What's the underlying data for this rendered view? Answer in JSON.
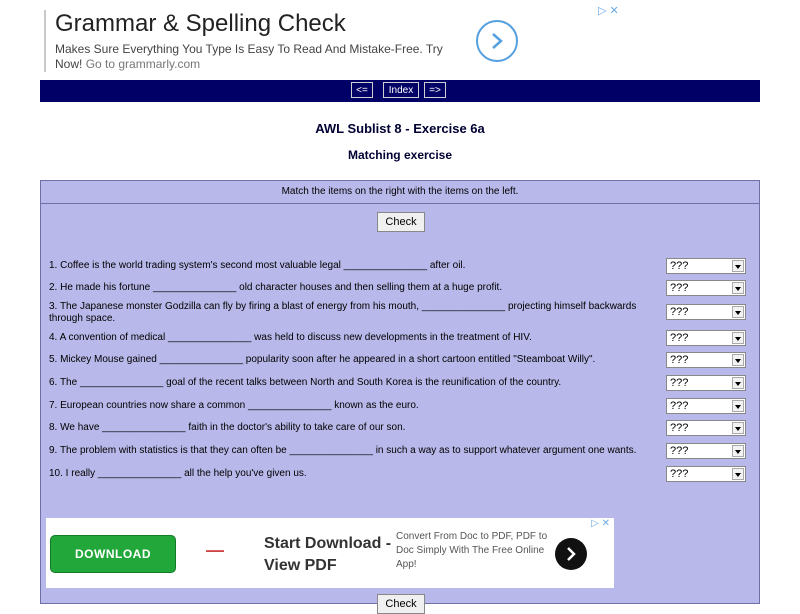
{
  "top_ad": {
    "title": "Grammar & Spelling Check",
    "description": "Makes Sure Everything You Type Is Easy To Read And Mistake-Free. Try Now!",
    "link": "Go to grammarly.com",
    "close": "▷ ✕"
  },
  "nav": {
    "prev": "<=",
    "index": "Index",
    "next": "=>"
  },
  "page": {
    "title": "AWL Sublist 8 - Exercise 6a",
    "subtitle": "Matching exercise"
  },
  "exercise": {
    "instruction": "Match the items on the right with the items on the left.",
    "check_label": "Check",
    "select_default": "???",
    "items": [
      "1. Coffee is the world trading system's second most valuable legal _______________ after oil.",
      "2. He made his fortune _______________ old character houses and then selling them at a huge profit.",
      "3. The Japanese monster Godzilla can fly by firing a blast of energy from his mouth, _______________ projecting himself backwards through space.",
      "4. A convention of medical _______________ was held to discuss new developments in the treatment of HIV.",
      "5. Mickey Mouse gained _______________ popularity soon after he appeared in a short cartoon entitled \"Steamboat Willy\".",
      "6. The _______________ goal of the recent talks between North and South Korea is the reunification of the country.",
      "7. European countries now share a common _______________ known as the euro.",
      "8. We have _______________ faith in the doctor's ability to take care of our son.",
      "9. The problem with statistics is that they can often be _______________ in such a way as to support whatever argument one wants.",
      "10. I really _______________ all the help you've given us."
    ]
  },
  "bottom_ad": {
    "close": "▷ ✕",
    "button": "DOWNLOAD",
    "title": "Start Download - View PDF",
    "description": "Convert From Doc to PDF, PDF to Doc Simply With The Free Online App!"
  }
}
